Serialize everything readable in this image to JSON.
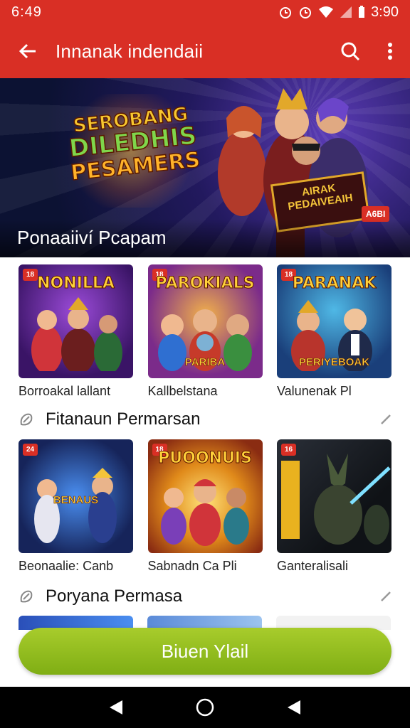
{
  "status_bar": {
    "time": "6:49",
    "battery": "3:90"
  },
  "app_bar": {
    "title": "Innanak indendaii"
  },
  "hero": {
    "logo_lines": [
      "SEROBANG",
      "DILEDHIS",
      "PESAMERS"
    ],
    "sign_lines": [
      "AIRAK",
      "PEDAIVEAIH"
    ],
    "badge": "A6BI",
    "caption": "Ponaaiiví Pcapam"
  },
  "row1": [
    {
      "tag": "18",
      "title": "NONILLA",
      "sub": "",
      "label": "Borroakal lallant"
    },
    {
      "tag": "18",
      "title": "PAROKIALS",
      "sub": "PARIBA",
      "label": "Kallbelstana"
    },
    {
      "tag": "18",
      "title": "PARANAK",
      "sub": "PERIYEBOAK",
      "label": "Valunenak Pl"
    }
  ],
  "section1": {
    "title": "Fitanaun Permarsan"
  },
  "row2": [
    {
      "tag": "24",
      "title": "",
      "sub": "BENAUS",
      "label": "Beonaalie: Canb"
    },
    {
      "tag": "18",
      "title": "PUOONUIS",
      "sub": "",
      "label": "Sabnadn Ca Pli"
    },
    {
      "tag": "16",
      "title": "",
      "sub": "",
      "label": "Ganteralisali"
    }
  ],
  "section2": {
    "title": "Poryana Permasa"
  },
  "cta": {
    "label": "Biuen Ylail"
  },
  "colors": {
    "primary": "#d92f25",
    "cta": "#8dba1c",
    "nav": "#000000"
  },
  "icons": [
    "back-arrow-icon",
    "search-icon",
    "more-vert-icon",
    "section-icon",
    "pencil-icon",
    "nav-back-icon",
    "nav-home-icon",
    "nav-recents-icon"
  ]
}
